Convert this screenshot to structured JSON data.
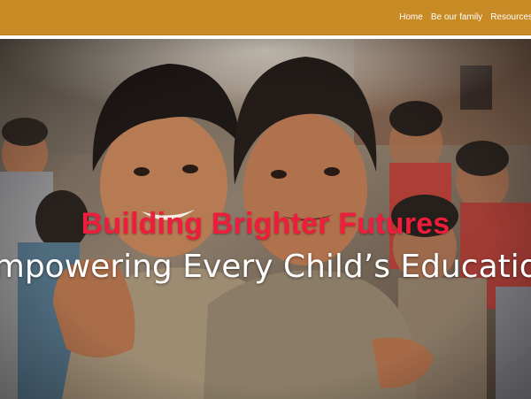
{
  "nav": {
    "items": [
      {
        "label": "Home"
      },
      {
        "label": "Be our family"
      },
      {
        "label": "Resources"
      }
    ]
  },
  "hero": {
    "title": "Building Brighter Futures",
    "subtitle": "Empowering Every Child’s Education",
    "colors": {
      "header_bg": "#c88a24",
      "title": "#ee1d3c",
      "subtitle": "#ffffff"
    }
  }
}
